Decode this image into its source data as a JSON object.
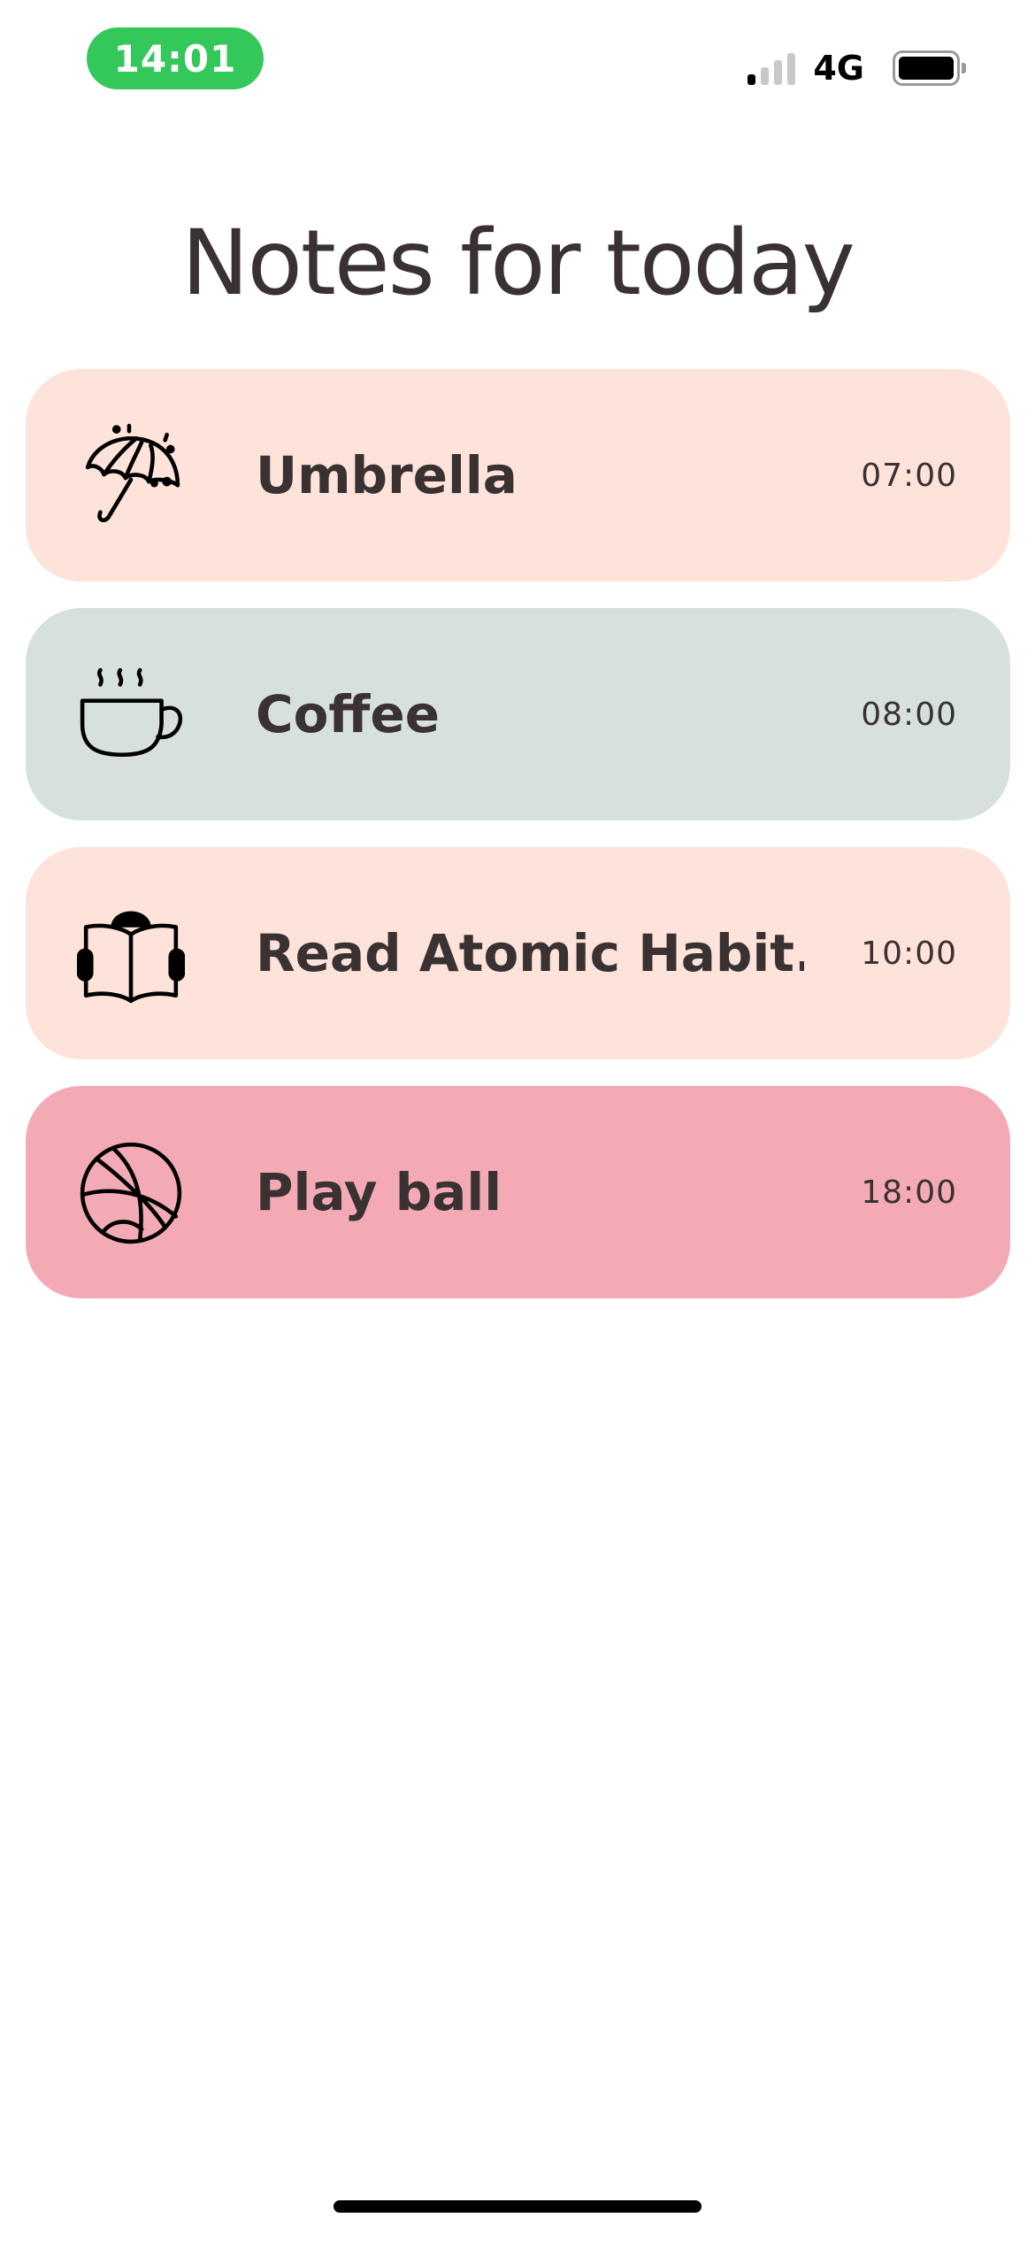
{
  "status_bar": {
    "time": "14:01",
    "time_bg_color": "#34c759",
    "network": "4G",
    "signal_bars_active": 1,
    "signal_bars_total": 4,
    "battery_level": 1.0
  },
  "header": {
    "title": "Notes for today"
  },
  "notes": [
    {
      "icon": "umbrella-icon",
      "label": "Umbrella",
      "time": "07:00",
      "color": "#fde3d9"
    },
    {
      "icon": "coffee-cup-icon",
      "label": "Coffee",
      "time": "08:00",
      "color": "#d7e1dc"
    },
    {
      "icon": "reading-book-icon",
      "label": "Read Atomic Habit...",
      "time": "10:00",
      "color": "#fde3d9"
    },
    {
      "icon": "basketball-icon",
      "label": "Play ball",
      "time": "18:00",
      "color": "#f3aab4"
    }
  ]
}
